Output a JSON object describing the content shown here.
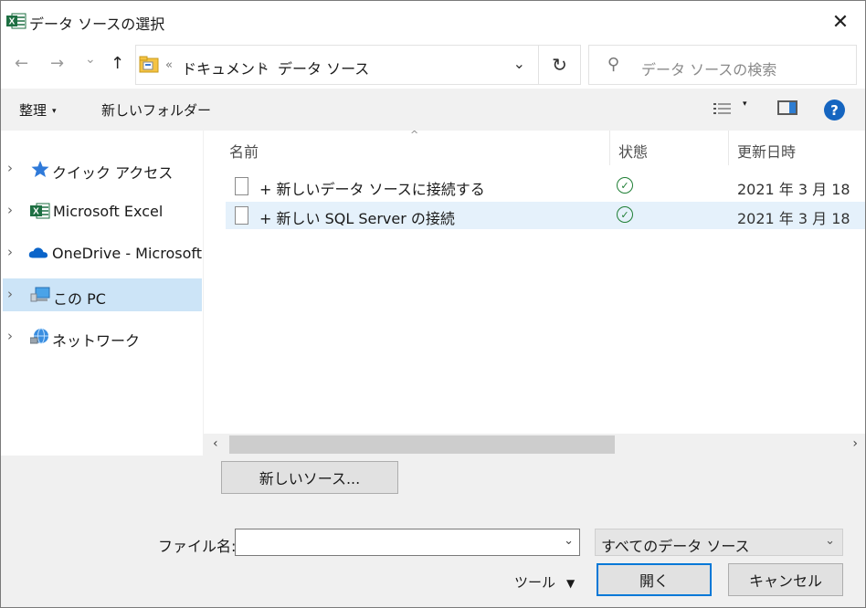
{
  "window": {
    "title": "データ ソースの選択",
    "app_icon": "excel-icon",
    "close_glyph": "✕"
  },
  "nav": {
    "back_glyph": "←",
    "forward_glyph": "→",
    "recent_glyph": "⌄",
    "up_glyph": "↑",
    "address": {
      "overflow": "«",
      "segments": [
        "ドキュメント",
        "データ ソース"
      ],
      "separator": "›",
      "dropdown_glyph": "⌄"
    },
    "refresh_glyph": "↻",
    "search_placeholder": "データ ソースの検索",
    "search_icon": "search-icon"
  },
  "toolbar": {
    "organize_label": "整理",
    "organize_caret": "▾",
    "new_folder_label": "新しいフォルダー",
    "view_caret": "▾",
    "help_glyph": "?"
  },
  "sidebar": {
    "chevron": "›",
    "items": [
      {
        "label": "クイック アクセス",
        "icon": "star-icon"
      },
      {
        "label": "Microsoft Excel",
        "icon": "excel-icon"
      },
      {
        "label": "OneDrive - Microsoft",
        "icon": "onedrive-cloud-icon"
      },
      {
        "label": "この PC",
        "icon": "pc-icon"
      },
      {
        "label": "ネットワーク",
        "icon": "network-icon"
      }
    ]
  },
  "filelist": {
    "columns": {
      "name": "名前",
      "status": "状態",
      "modified": "更新日時"
    },
    "sort_glyph": "^",
    "status_glyph": "✓",
    "rows": [
      {
        "name": "+ 新しいデータ ソースに接続する",
        "date": "2021 年 3 月 18"
      },
      {
        "name": "+ 新しい SQL Server の接続",
        "date": "2021 年 3 月 18"
      }
    ]
  },
  "scroll": {
    "left_glyph": "‹",
    "right_glyph": "›"
  },
  "bottom": {
    "new_source_label": "新しいソース...",
    "filename_label": "ファイル名:",
    "filename_value": "",
    "filename_dd": "⌄",
    "type_value": "すべてのデータ ソース",
    "type_dd": "⌄",
    "tools_label": "ツール",
    "tools_caret": "▼",
    "open_label": "開く",
    "cancel_label": "キャンセル"
  }
}
